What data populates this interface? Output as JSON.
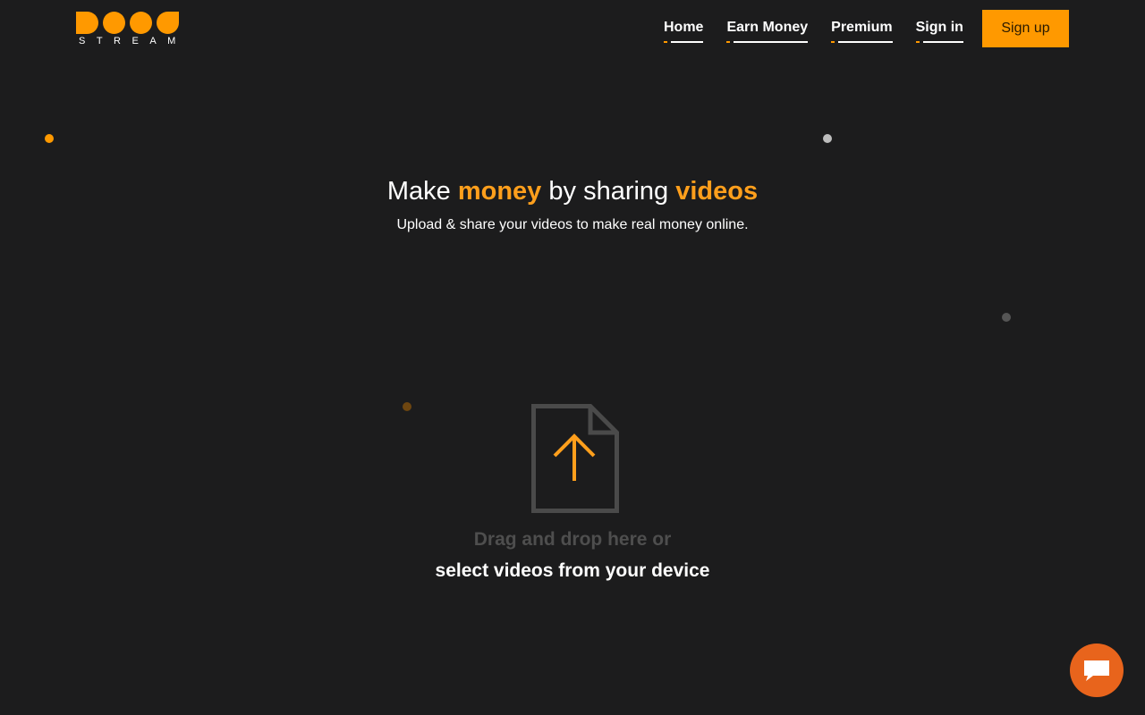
{
  "header": {
    "logo_text": "STREAM",
    "nav": [
      {
        "label": "Home"
      },
      {
        "label": "Earn Money"
      },
      {
        "label": "Premium"
      },
      {
        "label": "Sign in"
      }
    ],
    "signup_label": "Sign up"
  },
  "hero": {
    "title_part1": "Make ",
    "title_highlight1": "money",
    "title_part2": " by sharing ",
    "title_highlight2": "videos",
    "subtitle": "Upload & share your videos to make real money online."
  },
  "upload": {
    "icon": "file-upload-icon",
    "drag_text": "Drag and drop here or",
    "select_text": "select videos from your device"
  },
  "chat": {
    "icon": "chat-bubble-icon"
  },
  "colors": {
    "background": "#1c1c1d",
    "accent": "#ff9900",
    "chat": "#e8641c"
  }
}
